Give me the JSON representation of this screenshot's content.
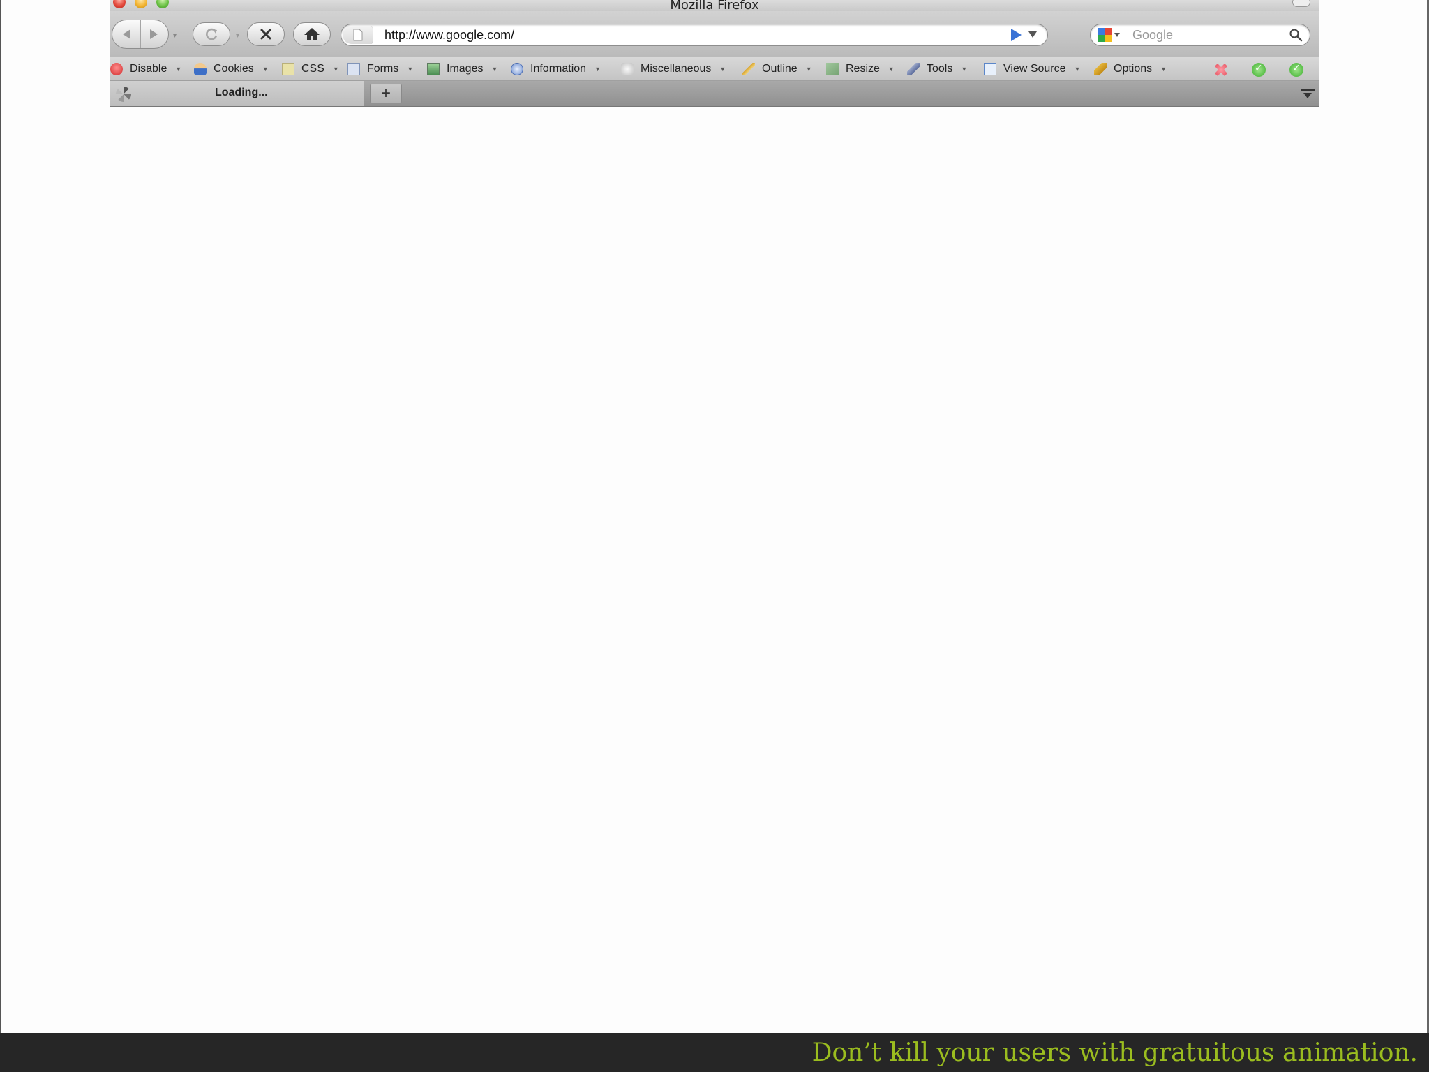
{
  "window": {
    "title": "Mozilla Firefox"
  },
  "navigation": {
    "url": "http://www.google.com/",
    "search_placeholder": "Google"
  },
  "dev_toolbar": {
    "items": [
      {
        "label": "Disable",
        "icon": "disable-icon"
      },
      {
        "label": "Cookies",
        "icon": "cookies-icon"
      },
      {
        "label": "CSS",
        "icon": "css-icon"
      },
      {
        "label": "Forms",
        "icon": "forms-icon"
      },
      {
        "label": "Images",
        "icon": "images-icon"
      },
      {
        "label": "Information",
        "icon": "information-icon"
      },
      {
        "label": "Miscellaneous",
        "icon": "miscellaneous-icon"
      },
      {
        "label": "Outline",
        "icon": "outline-icon"
      },
      {
        "label": "Resize",
        "icon": "resize-icon"
      },
      {
        "label": "Tools",
        "icon": "tools-icon"
      },
      {
        "label": "View Source",
        "icon": "view-source-icon"
      },
      {
        "label": "Options",
        "icon": "options-icon"
      }
    ],
    "status_icons": [
      "error-status-icon",
      "valid-status-icon",
      "valid-status-icon"
    ]
  },
  "tabs": {
    "active": {
      "label": "Loading..."
    },
    "new_tab_label": "+"
  },
  "caption": {
    "text": "Don’t kill your users with gratuitous animation."
  },
  "colors": {
    "caption_text": "#9bbd1f",
    "caption_bg": "#262626"
  }
}
